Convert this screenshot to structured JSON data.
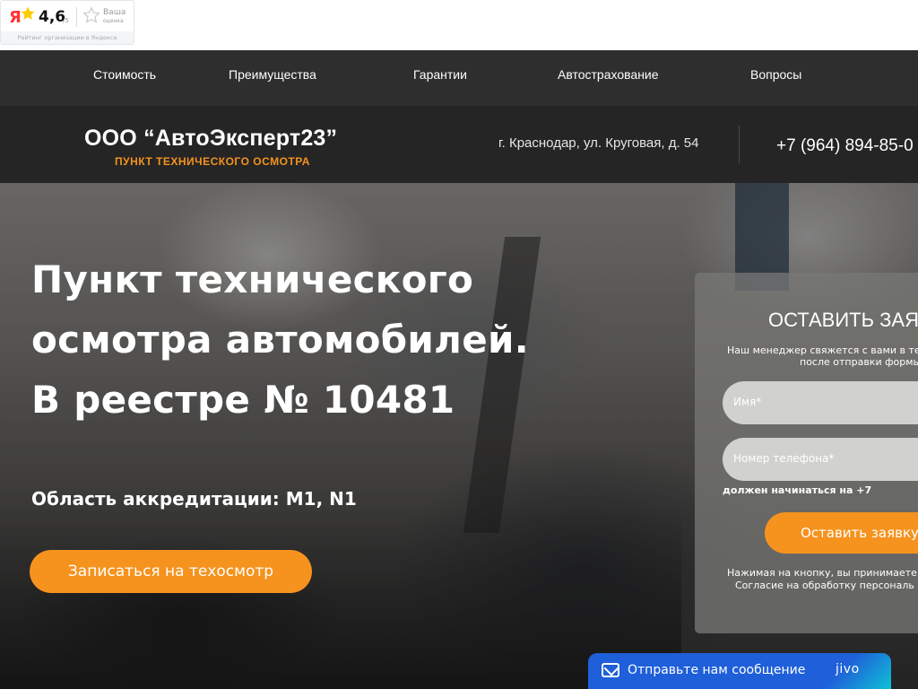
{
  "yandex_widget": {
    "logo": "Я",
    "rating": "4,6",
    "rating_of": "/5",
    "your_rating_line1": "Ваша",
    "your_rating_line2": "оценка",
    "footer": "Рейтинг организации в Яндексе"
  },
  "nav": {
    "items": [
      {
        "label": "Стоимость"
      },
      {
        "label": "Преимущества"
      },
      {
        "label": "Гарантии"
      },
      {
        "label": "Автострахование"
      },
      {
        "label": "Вопросы"
      }
    ]
  },
  "header": {
    "title": "ООО “АвтоЭксперт23”",
    "subtitle": "ПУНКТ ТЕХНИЧЕСКОГО ОСМОТРА",
    "address": "г. Краснодар, ул. Круговая, д. 54",
    "phone": "+7 (964) 894-85-0"
  },
  "hero": {
    "title_lines": [
      "Пункт технического",
      "осмотра автомобилей.",
      "В реестре № 10481"
    ],
    "accreditation": "Область аккредитации: M1, N1",
    "cta_label": "Записаться на техосмотр"
  },
  "form": {
    "title": "ОСТАВИТЬ ЗАЯВ",
    "subtitle_lines": [
      "Наш менеджер свяжется с вами в тече",
      "после отправки формы"
    ],
    "name_placeholder": "Имя*",
    "phone_placeholder": "Номер телефона*",
    "phone_hint": "должен начинаться на +7",
    "submit_label": "Оставить заявку",
    "consent_lines": [
      "Нажимая на кнопку, вы принимаете",
      "Согласие на обработку персональ"
    ]
  },
  "chat": {
    "label": "Отправьте нам сообщение",
    "brand": "jivo"
  },
  "colors": {
    "accent": "#f5931e",
    "nav_bg": "#2e2e2e",
    "header_bg": "#252525",
    "chat_bg": "#1f5fd9"
  }
}
